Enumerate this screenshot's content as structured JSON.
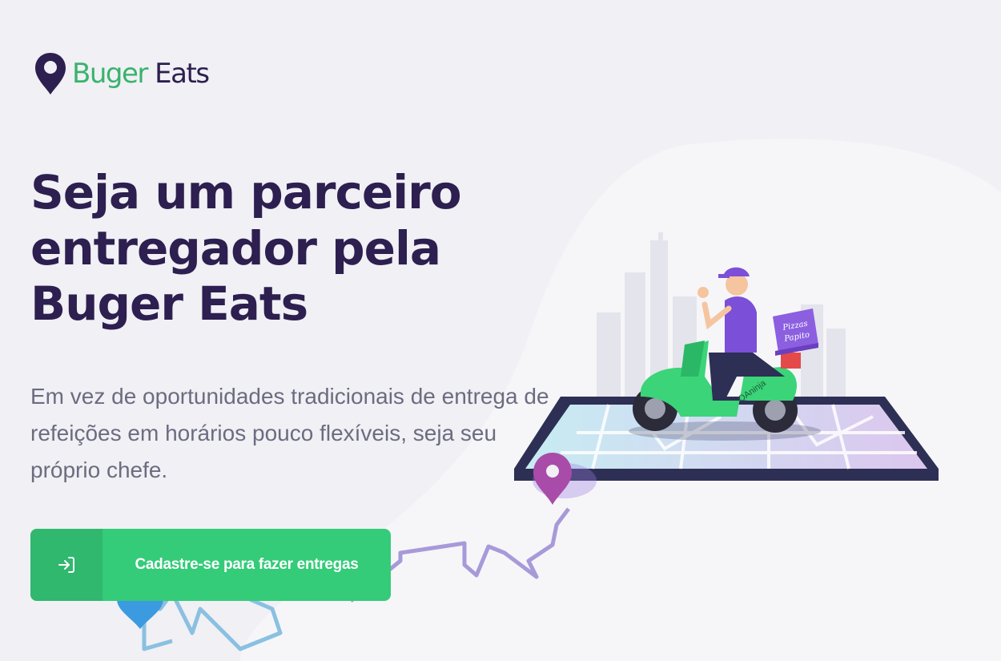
{
  "brand": {
    "name_part1": "Buger",
    "name_part2": "Eats",
    "icon": "map-pin-icon",
    "colors": {
      "primary_dark": "#2d1f4f",
      "accent_green": "#34cb79",
      "text_muted": "#6c6c80"
    }
  },
  "hero": {
    "title_lines": [
      "Seja um parceiro",
      "entregador pela",
      "Buger Eats"
    ],
    "description_lines": [
      "Em vez de oportunidades tradicionais de entrega de",
      "refeições em horários pouco flexíveis, seja seu",
      "próprio chefe."
    ]
  },
  "cta": {
    "label": "Cadastre-se para fazer entregas",
    "icon": "sign-in-icon"
  },
  "illustration": {
    "box_text_line1": "Pizzas",
    "box_text_line2": "Papito",
    "scooter_text": "QAninja"
  }
}
